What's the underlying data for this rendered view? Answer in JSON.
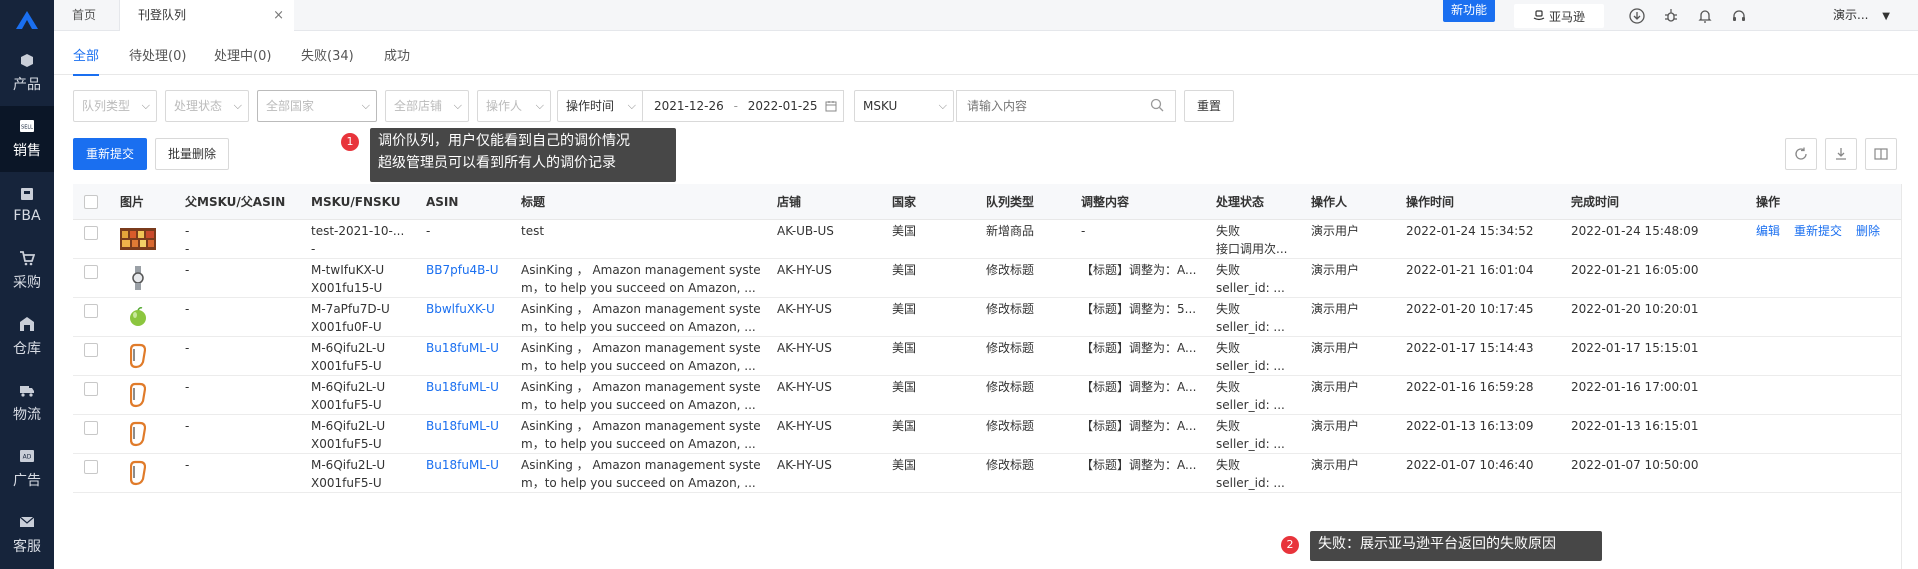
{
  "sidebar": {
    "items": [
      {
        "label": "产品",
        "icon": "box-icon"
      },
      {
        "label": "销售",
        "icon": "sell-icon"
      },
      {
        "label": "FBA",
        "icon": "fba-icon"
      },
      {
        "label": "采购",
        "icon": "cart-icon"
      },
      {
        "label": "仓库",
        "icon": "warehouse-icon"
      },
      {
        "label": "物流",
        "icon": "truck-icon"
      },
      {
        "label": "广告",
        "icon": "ad-icon"
      },
      {
        "label": "客服",
        "icon": "mail-icon"
      }
    ]
  },
  "topbar": {
    "home_tab": "首页",
    "current_tab": "刊登队列",
    "close": "×",
    "new_feature": "新功能",
    "market": "亚马逊",
    "user": "演示..."
  },
  "status_tabs": [
    "全部",
    "待处理(0)",
    "处理中(0)",
    "失败(34)",
    "成功"
  ],
  "filters": {
    "queue_type": "队列类型",
    "process_status": "处理状态",
    "all_countries": "全部国家",
    "all_stores": "全部店铺",
    "operator": "操作人",
    "time_type": "操作时间",
    "date_start": "2021-12-26",
    "date_sep": "-",
    "date_end": "2022-01-25",
    "search_field": "MSKU",
    "search_placeholder": "请输入内容",
    "reset": "重置"
  },
  "actions": {
    "resubmit": "重新提交",
    "batch_delete": "批量删除"
  },
  "tooltips": {
    "tip1_num": "1",
    "tip1_line1": "调价队列，用户仅能看到自己的调价情况",
    "tip1_line2": "超级管理员可以看到所有人的调价记录",
    "tip2_num": "2",
    "tip2_text": "失败：展示亚马逊平台返回的失败原因"
  },
  "table": {
    "headers": [
      "图片",
      "父MSKU/父ASIN",
      "MSKU/FNSKU",
      "ASIN",
      "标题",
      "店铺",
      "国家",
      "队列类型",
      "调整内容",
      "处理状态",
      "操作人",
      "操作时间",
      "完成时间",
      "操作"
    ],
    "rows": [
      {
        "thumb": "shelf",
        "parent1": "-",
        "parent2": "-",
        "msku": "test-2021-10-...",
        "fnsku": "-",
        "asin": "-",
        "asin_link": false,
        "title1": "test",
        "title2": "",
        "store": "AK-UB-US",
        "country": "美国",
        "queue": "新增商品",
        "adjust": "-",
        "status1": "失败",
        "status2": "接口调用次...",
        "operator": "演示用户",
        "op_time": "2022-01-24 15:34:52",
        "done_time": "2022-01-24 15:48:09",
        "ops": [
          "编辑",
          "重新提交",
          "删除"
        ]
      },
      {
        "thumb": "watch",
        "parent1": "-",
        "parent2": "",
        "msku": "M-twIfuKX-U",
        "fnsku": "X001fu15-U",
        "asin": "BB7pfu4B-U",
        "asin_link": true,
        "title1": "AsinKing ， Amazon management syste",
        "title2": "m，to help you succeed on Amazon, ...",
        "store": "AK-HY-US",
        "country": "美国",
        "queue": "修改标题",
        "adjust": "【标题】调整为：A...",
        "status1": "失败",
        "status2": "seller_id: ...",
        "operator": "演示用户",
        "op_time": "2022-01-21 16:01:04",
        "done_time": "2022-01-21 16:05:00",
        "ops": []
      },
      {
        "thumb": "apple",
        "parent1": "-",
        "parent2": "",
        "msku": "M-7aPfu7D-U",
        "fnsku": "X001fu0F-U",
        "asin": "BbwlfuXK-U",
        "asin_link": true,
        "title1": "AsinKing ， Amazon management syste",
        "title2": "m，to help you succeed on Amazon, ...",
        "store": "AK-HY-US",
        "country": "美国",
        "queue": "修改标题",
        "adjust": "【标题】调整为：5...",
        "status1": "失败",
        "status2": "seller_id: ...",
        "operator": "演示用户",
        "op_time": "2022-01-20 10:17:45",
        "done_time": "2022-01-20 10:20:01",
        "ops": []
      },
      {
        "thumb": "carabiner",
        "parent1": "-",
        "parent2": "",
        "msku": "M-6Qifu2L-U",
        "fnsku": "X001fuF5-U",
        "asin": "Bu18fuML-U",
        "asin_link": true,
        "title1": "AsinKing ， Amazon management syste",
        "title2": "m，to help you succeed on Amazon, ...",
        "store": "AK-HY-US",
        "country": "美国",
        "queue": "修改标题",
        "adjust": "【标题】调整为：A...",
        "status1": "失败",
        "status2": "seller_id: ...",
        "operator": "演示用户",
        "op_time": "2022-01-17 15:14:43",
        "done_time": "2022-01-17 15:15:01",
        "ops": []
      },
      {
        "thumb": "carabiner",
        "parent1": "-",
        "parent2": "",
        "msku": "M-6Qifu2L-U",
        "fnsku": "X001fuF5-U",
        "asin": "Bu18fuML-U",
        "asin_link": true,
        "title1": "AsinKing ， Amazon management syste",
        "title2": "m，to help you succeed on Amazon, ...",
        "store": "AK-HY-US",
        "country": "美国",
        "queue": "修改标题",
        "adjust": "【标题】调整为：A...",
        "status1": "失败",
        "status2": "seller_id: ...",
        "operator": "演示用户",
        "op_time": "2022-01-16 16:59:28",
        "done_time": "2022-01-16 17:00:01",
        "ops": []
      },
      {
        "thumb": "carabiner",
        "parent1": "-",
        "parent2": "",
        "msku": "M-6Qifu2L-U",
        "fnsku": "X001fuF5-U",
        "asin": "Bu18fuML-U",
        "asin_link": true,
        "title1": "AsinKing ， Amazon management syste",
        "title2": "m，to help you succeed on Amazon, ...",
        "store": "AK-HY-US",
        "country": "美国",
        "queue": "修改标题",
        "adjust": "【标题】调整为：A...",
        "status1": "失败",
        "status2": "seller_id: ...",
        "operator": "演示用户",
        "op_time": "2022-01-13 16:13:09",
        "done_time": "2022-01-13 16:15:01",
        "ops": []
      },
      {
        "thumb": "carabiner",
        "parent1": "-",
        "parent2": "",
        "msku": "M-6Qifu2L-U",
        "fnsku": "X001fuF5-U",
        "asin": "Bu18fuML-U",
        "asin_link": true,
        "title1": "AsinKing ， Amazon management syste",
        "title2": "m，to help you succeed on Amazon, ...",
        "store": "AK-HY-US",
        "country": "美国",
        "queue": "修改标题",
        "adjust": "【标题】调整为：A...",
        "status1": "失败",
        "status2": "seller_id: ...",
        "operator": "演示用户",
        "op_time": "2022-01-07 10:46:40",
        "done_time": "2022-01-07 10:50:00",
        "ops": []
      }
    ]
  },
  "colors": {
    "primary": "#1a6ff0",
    "sidebar": "#16243b",
    "tooltip": "#474747",
    "badge": "#e8343b"
  }
}
